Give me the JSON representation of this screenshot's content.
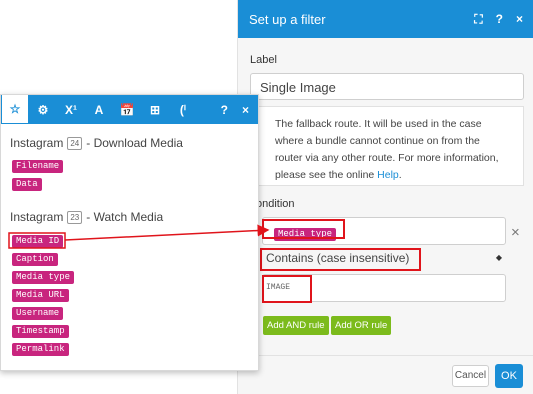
{
  "dialog": {
    "title": "Set up a filter",
    "header_icons": [
      "⛶",
      "?",
      "×"
    ],
    "label_field_label": "Label",
    "label_value": "Single Image",
    "help_text": "The fallback route. It will be used in the case where a bundle cannot continue on from the router via any other route. For more information, please see the online",
    "help_link": "Help",
    "help_end": ".",
    "condition_label": "ondition",
    "condition_value": "Media type",
    "remove_icon": "×",
    "operator": "Contains (case insensitive)",
    "operator_caret": "◆",
    "value_text": "IMAGE",
    "add_and": "Add AND rule",
    "add_or": "Add OR rule",
    "cancel": "Cancel",
    "ok": "OK"
  },
  "panel": {
    "tabs": [
      "☆",
      "⚙",
      "X¹",
      "A",
      "📅",
      "⊞",
      "(ⁱ"
    ],
    "right_icons": [
      "?",
      "×"
    ],
    "module1": {
      "name": "Instagram",
      "badge": "24",
      "suffix": "- Download Media",
      "items": [
        "Filename",
        "Data"
      ]
    },
    "module2": {
      "name": "Instagram",
      "badge": "23",
      "suffix": "- Watch Media",
      "items": [
        "Media ID",
        "Caption",
        "Media type",
        "Media URL",
        "Username",
        "Timestamp",
        "Permalink"
      ]
    }
  },
  "colors": {
    "accent": "#1a8ed6",
    "pill": "#c8257e",
    "green": "#7cbb1c",
    "highlight": "#e0141b"
  }
}
